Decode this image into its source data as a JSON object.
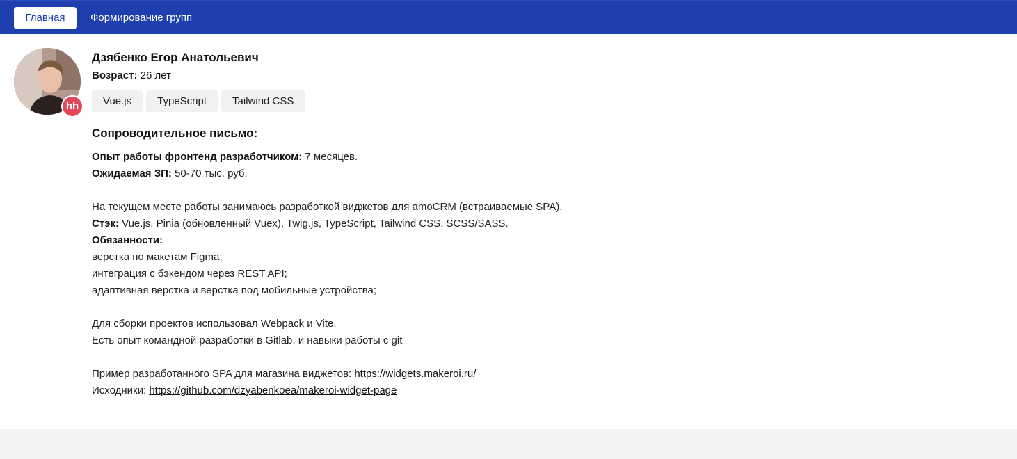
{
  "nav": {
    "home_label": "Главная",
    "groups_label": "Формирование групп"
  },
  "profile": {
    "name": "Дзябенко Егор Анатольевич",
    "age_label": "Возраст:",
    "age_value": "26 лет",
    "badge": "hh",
    "tags": [
      "Vue.js",
      "TypeScript",
      "Tailwind CSS"
    ]
  },
  "letter": {
    "title": "Сопроводительное письмо:",
    "experience_label": "Опыт работы фронтенд разработчиком:",
    "experience_value": "7 месяцев.",
    "salary_label": "Ожидаемая ЗП:",
    "salary_value": "50-70 тыс. руб.",
    "current_job": "На текущем месте работы занимаюсь разработкой виджетов для amoCRM (встраиваемые SPA).",
    "stack_label": "Стэк:",
    "stack_value": "Vue.js, Pinia (обновленный Vuex), Twig.js, TypeScript, Tailwind CSS, SCSS/SASS.",
    "duties_label": "Обязанности:",
    "duties": [
      "верстка по макетам Figma;",
      "интеграция с бэкендом через REST API;",
      "адаптивная верстка и верстка под мобильные устройства;"
    ],
    "build_tools": "Для сборки проектов использовал Webpack и Vite.",
    "team_experience": "Есть опыт командной разработки в Gitlab, и навыки работы с git",
    "example_label": "Пример разработанного SPA для магазина виджетов:",
    "example_link": "https://widgets.makeroi.ru/",
    "source_label": "Исходники:",
    "source_link": "https://github.com/dzyabenkoea/makeroi-widget-page"
  }
}
